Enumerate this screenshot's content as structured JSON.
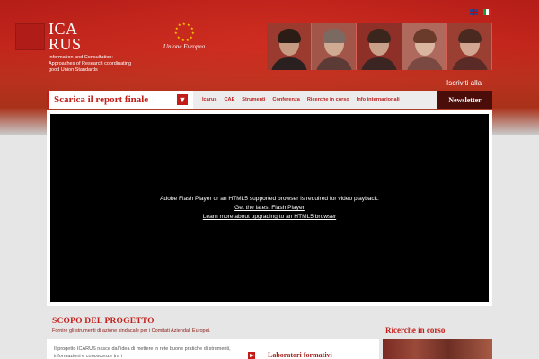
{
  "header": {
    "logo_line1": "ICA",
    "logo_line2": "RUS",
    "logo_subtitle": "Information and Consultation: Approaches of Research coordinating good Union Standards",
    "eu_label": "Unione Europea",
    "languages": [
      "uk-flag-icon",
      "it-flag-icon"
    ],
    "iscriviti": "Iscriviti alla"
  },
  "nav": {
    "download_label": "Scarica il report finale",
    "download_icon": "arrow-down-icon",
    "menu": [
      "Icarus",
      "CAE",
      "Strumenti",
      "Conferenza",
      "Ricerche in corso",
      "Info internazionali"
    ],
    "newsletter": "Newsletter"
  },
  "video": {
    "message": "Adobe Flash Player or an HTML5 supported browser is required for video playback.",
    "link1": "Get the latest Flash Player",
    "link2": "Learn more about upgrading to an HTML5 browser"
  },
  "scopo": {
    "title": "SCOPO DEL PROGETTO",
    "subtitle": "Fornire gli strumenti di azione sindacale per i Comitati Aziendali Europei.",
    "body": "Il progetto ICARUS nasce dall'idea di mettere in rete buone pratiche di strumenti, informazioni e conoscenze tra i",
    "lab_label": "Laboratori formativi"
  },
  "sidebar": {
    "title": "Ricerche in corso"
  },
  "colors": {
    "brand_red": "#c21d18",
    "dark_red": "#4a0d0a"
  }
}
